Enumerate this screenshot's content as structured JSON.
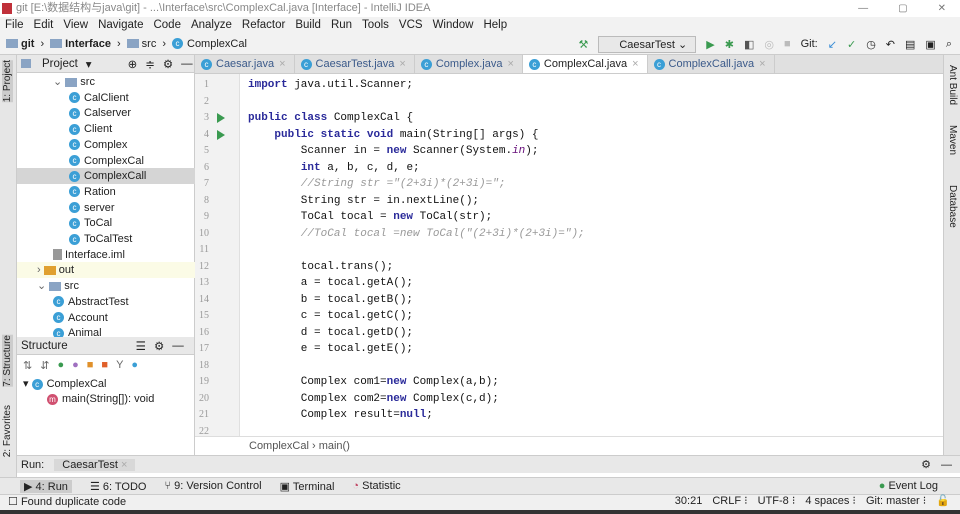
{
  "window": {
    "title": "git [E:\\数据结构与java\\git] - ...\\Interface\\src\\ComplexCal.java [Interface] - IntelliJ IDEA",
    "controls": [
      "—",
      "▢",
      "✕"
    ]
  },
  "menu": [
    "File",
    "Edit",
    "View",
    "Navigate",
    "Code",
    "Analyze",
    "Refactor",
    "Build",
    "Run",
    "Tools",
    "VCS",
    "Window",
    "Help"
  ],
  "breadcrumb": [
    "git",
    "Interface",
    "src",
    "ComplexCal"
  ],
  "toolbar": {
    "run_config": "CaesarTest",
    "git_label": "Git:"
  },
  "left_strip": {
    "project": "1: Project",
    "structure": "7: Structure",
    "favorites": "2: Favorites"
  },
  "right_strip": [
    "Ant Build",
    "Maven",
    "Database"
  ],
  "project": {
    "title": "Project",
    "tree": [
      {
        "label": "src",
        "kind": "folder",
        "depth": 2
      },
      {
        "label": "CalClient",
        "kind": "class",
        "depth": 3
      },
      {
        "label": "Calserver",
        "kind": "class",
        "depth": 3
      },
      {
        "label": "Client",
        "kind": "class",
        "depth": 3
      },
      {
        "label": "Complex",
        "kind": "class",
        "depth": 3
      },
      {
        "label": "ComplexCal",
        "kind": "class",
        "depth": 3
      },
      {
        "label": "ComplexCall",
        "kind": "class",
        "depth": 3,
        "selected": true
      },
      {
        "label": "Ration",
        "kind": "class",
        "depth": 3
      },
      {
        "label": "server",
        "kind": "class",
        "depth": 3
      },
      {
        "label": "ToCal",
        "kind": "class",
        "depth": 3
      },
      {
        "label": "ToCalTest",
        "kind": "class",
        "depth": 3
      },
      {
        "label": "Interface.iml",
        "kind": "file",
        "depth": 2
      },
      {
        "label": "out",
        "kind": "folder",
        "depth": 1,
        "highlight": true
      },
      {
        "label": "src",
        "kind": "folder",
        "depth": 1
      },
      {
        "label": "AbstractTest",
        "kind": "class",
        "depth": 2
      },
      {
        "label": "Account",
        "kind": "class",
        "depth": 2
      },
      {
        "label": "Animal",
        "kind": "class",
        "depth": 2
      }
    ]
  },
  "structure": {
    "title": "Structure",
    "items": [
      {
        "label": "ComplexCal",
        "depth": 0
      },
      {
        "label": "main(String[]): void",
        "depth": 1
      }
    ]
  },
  "tabs": [
    {
      "label": "Caesar.java"
    },
    {
      "label": "CaesarTest.java"
    },
    {
      "label": "Complex.java"
    },
    {
      "label": "ComplexCal.java",
      "active": true
    },
    {
      "label": "ComplexCall.java"
    }
  ],
  "code": [
    "import java.util.Scanner;",
    "",
    "public class ComplexCal {",
    "    public static void main(String[] args) {",
    "        Scanner in = new Scanner(System.in);",
    "        int a, b, c, d, e;",
    "        //String str =\"(2+3i)*(2+3i)=\";",
    "        String str = in.nextLine();",
    "        ToCal tocal = new ToCal(str);",
    "        //ToCal tocal =new ToCal(\"(2+3i)*(2+3i)=\");",
    "",
    "        tocal.trans();",
    "        a = tocal.getA();",
    "        b = tocal.getB();",
    "        c = tocal.getC();",
    "        d = tocal.getD();",
    "        e = tocal.getE();",
    "",
    "        Complex com1=new Complex(a,b);",
    "        Complex com2=new Complex(c,d);",
    "        Complex result=null;",
    ""
  ],
  "editor_breadcrumb": [
    "ComplexCal",
    "main()"
  ],
  "run": {
    "label": "Run:",
    "tab": "CaesarTest"
  },
  "tool_windows": [
    "4: Run",
    "6: TODO",
    "9: Version Control",
    "Terminal",
    "Statistic",
    "Event Log"
  ],
  "status": {
    "message": "Found duplicate code",
    "position": "30:21",
    "line_sep": "CRLF",
    "encoding": "UTF-8",
    "indent": "4 spaces",
    "vcs": "Git: master"
  }
}
